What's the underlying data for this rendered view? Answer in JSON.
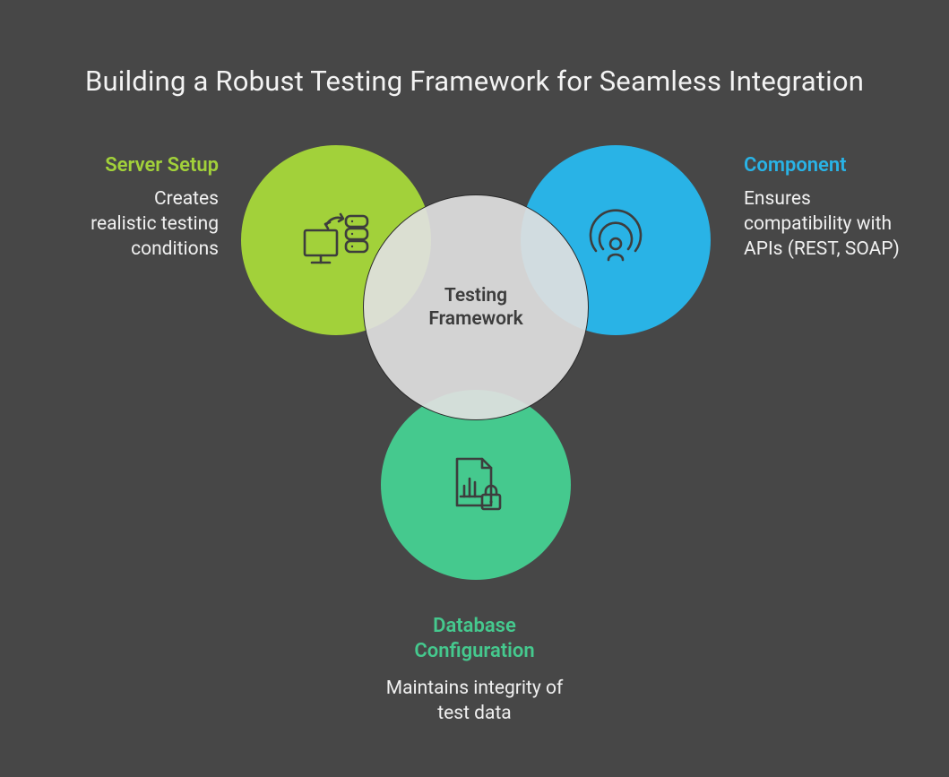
{
  "title": "Building a Robust Testing Framework for Seamless Integration",
  "center": {
    "label": "Testing\nFramework"
  },
  "left": {
    "heading": "Server Setup",
    "desc": "Creates\nrealistic testing\nconditions",
    "icon": "server-sync-icon",
    "color": "#a2d13a"
  },
  "right": {
    "heading": "Component",
    "desc": "Ensures compatibility with APIs (REST, SOAP)",
    "icon": "broadcast-icon",
    "color": "#29b3e6"
  },
  "bottom": {
    "heading": "Database\nConfiguration",
    "desc": "Maintains integrity of test data",
    "icon": "secure-data-icon",
    "color": "#45c98e"
  }
}
